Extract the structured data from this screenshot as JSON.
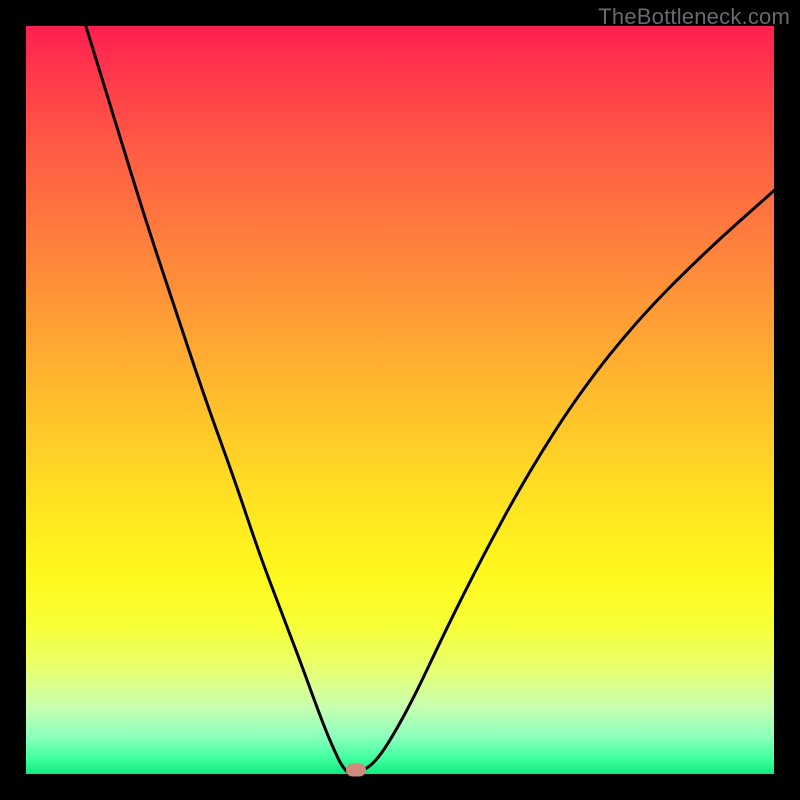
{
  "watermark": "TheBottleneck.com",
  "chart_data": {
    "type": "line",
    "title": "",
    "xlabel": "",
    "ylabel": "",
    "xlim": [
      0,
      100
    ],
    "ylim": [
      0,
      100
    ],
    "grid": false,
    "series": [
      {
        "name": "bottleneck-curve",
        "x": [
          8,
          12,
          16,
          20,
          24,
          28,
          31,
          34,
          36.5,
          38.5,
          40,
          41.2,
          42,
          42.7,
          43.3,
          45.3,
          47,
          49,
          52,
          56,
          61,
          67,
          74,
          82,
          91,
          100
        ],
        "y": [
          100,
          87,
          74,
          62,
          50,
          39,
          30,
          22,
          15.5,
          10,
          6,
          3.2,
          1.5,
          0.5,
          0,
          0.5,
          2,
          5,
          10.5,
          19,
          29,
          40,
          51,
          61,
          70,
          78
        ]
      }
    ],
    "marker": {
      "x": 44.1,
      "y": 0.6
    },
    "background_gradient": {
      "direction": "vertical",
      "stops": [
        {
          "pos": 0,
          "color": "#ff1f52"
        },
        {
          "pos": 27,
          "color": "#ff7a3e"
        },
        {
          "pos": 58,
          "color": "#ffd326"
        },
        {
          "pos": 80,
          "color": "#e8ff70"
        },
        {
          "pos": 100,
          "color": "#12e880"
        }
      ]
    }
  }
}
